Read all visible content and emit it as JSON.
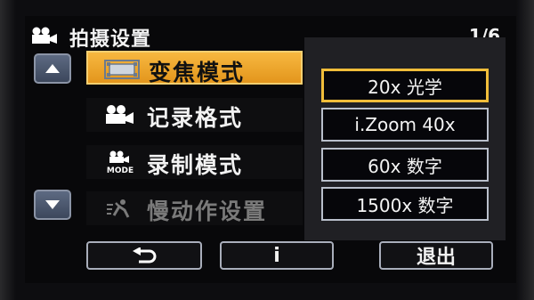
{
  "header": {
    "title": "拍摄设置",
    "page_indicator": "1/6",
    "icon": "video-camera-icon"
  },
  "menu": {
    "items": [
      {
        "label": "变焦模式",
        "icon": "zoom-mode-icon",
        "selected": true
      },
      {
        "label": "记录格式",
        "icon": "video-camera-icon",
        "selected": false
      },
      {
        "label": "录制模式",
        "icon": "camera-mode-icon",
        "icon_text": "MODE",
        "selected": false
      },
      {
        "label": "慢动作设置",
        "icon": "slow-motion-icon",
        "selected": false,
        "disabled": true
      }
    ]
  },
  "options": [
    {
      "label": "20x 光学",
      "selected": true
    },
    {
      "label": "i.Zoom 40x",
      "selected": false
    },
    {
      "label": "60x 数字",
      "selected": false
    },
    {
      "label": "1500x 数字",
      "selected": false
    }
  ],
  "bottom": {
    "back_icon": "return-arrow-icon",
    "info_label": "i",
    "exit_label": "退出"
  },
  "colors": {
    "accent": "#f0b030",
    "background": "#08080a",
    "button_border": "#a9aebb"
  }
}
